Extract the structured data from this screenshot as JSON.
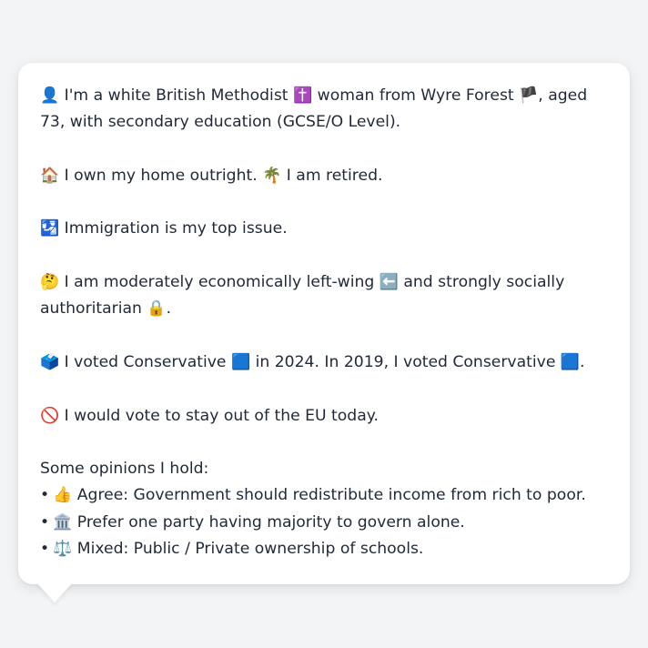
{
  "profile": {
    "identity": {
      "icon": "👤",
      "t1": " I'm a white British Methodist ",
      "icon2": "✝️",
      "t2": " woman from Wyre Forest ",
      "icon3": "🏴",
      "t3": ", aged 73, with secondary education (GCSE/O Level)."
    },
    "home": {
      "icon": "🏠",
      "t1": " I own my home outright. ",
      "icon2": "🌴",
      "t2": " I am retired."
    },
    "issue": {
      "icon": "🛂",
      "t1": " Immigration is my top issue."
    },
    "ideology": {
      "icon": "🤔",
      "t1": " I am moderately economically left-wing ",
      "icon2": "⬅️",
      "t2": " and strongly socially authoritarian ",
      "icon3": "🔒",
      "t3": "."
    },
    "vote": {
      "icon": "🗳️",
      "t1": " I voted Conservative ",
      "icon2": "🟦",
      "t2": " in 2024. In 2019, I voted Conservative ",
      "icon3": "🟦",
      "t3": "."
    },
    "eu": {
      "icon": "🚫",
      "t1": " I would vote to stay out of the EU today."
    },
    "opinions": {
      "header": "Some opinions I hold:",
      "bullet": "•",
      "items": [
        {
          "icon": "👍",
          "text": " Agree: Government should redistribute income from rich to poor."
        },
        {
          "icon": "🏛️",
          "text": " Prefer one party having majority to govern alone."
        },
        {
          "icon": "⚖️",
          "text": " Mixed: Public / Private ownership of schools."
        }
      ]
    }
  }
}
